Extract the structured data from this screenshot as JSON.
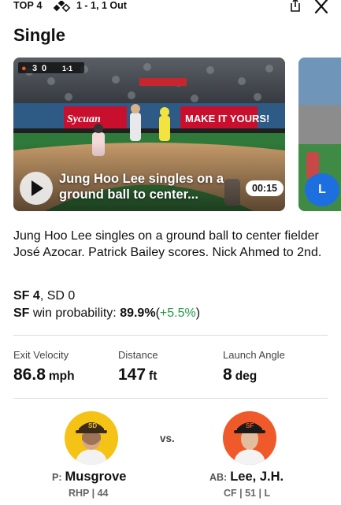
{
  "header": {
    "inning": "TOP 4",
    "count": "1 - 1, 1 Out"
  },
  "title": "Single",
  "video": {
    "caption": "Jung Hoo Lee singles on a ground ball to center...",
    "duration": "00:15",
    "scoreboard": {
      "away_score": "3",
      "home_score": "0",
      "count": "1-1"
    },
    "banners": {
      "left": "Sycuan",
      "right": "MAKE IT YOURS!"
    }
  },
  "next_video": {
    "button_letter": "L"
  },
  "description": "Jung Hoo Lee singles on a ground ball to center fielder José Azocar. Patrick Bailey scores. Nick Ahmed to 2nd.",
  "score": {
    "team1": "SF",
    "score1": "4",
    "team2": "SD",
    "score2": "0"
  },
  "win_probability": {
    "team": "SF",
    "label": "win probability:",
    "value": "89.9%",
    "open": "(",
    "change": "+5.5%",
    "close": ")"
  },
  "stats": [
    {
      "label": "Exit Velocity",
      "value": "86.8",
      "unit": "mph"
    },
    {
      "label": "Distance",
      "value": "147",
      "unit": "ft"
    },
    {
      "label": "Launch Angle",
      "value": "8",
      "unit": "deg"
    }
  ],
  "matchup": {
    "vs": "vs.",
    "pitcher": {
      "role": "P:",
      "name": "Musgrove",
      "meta": "RHP | 44",
      "team_color": "#f5c315"
    },
    "batter": {
      "role": "AB:",
      "name": "Lee, J.H.",
      "meta": "CF | 51 | L",
      "team_color": "#f0592a"
    }
  },
  "colors": {
    "positive": "#1d9b43",
    "video_cta": "#1d6fe0"
  }
}
